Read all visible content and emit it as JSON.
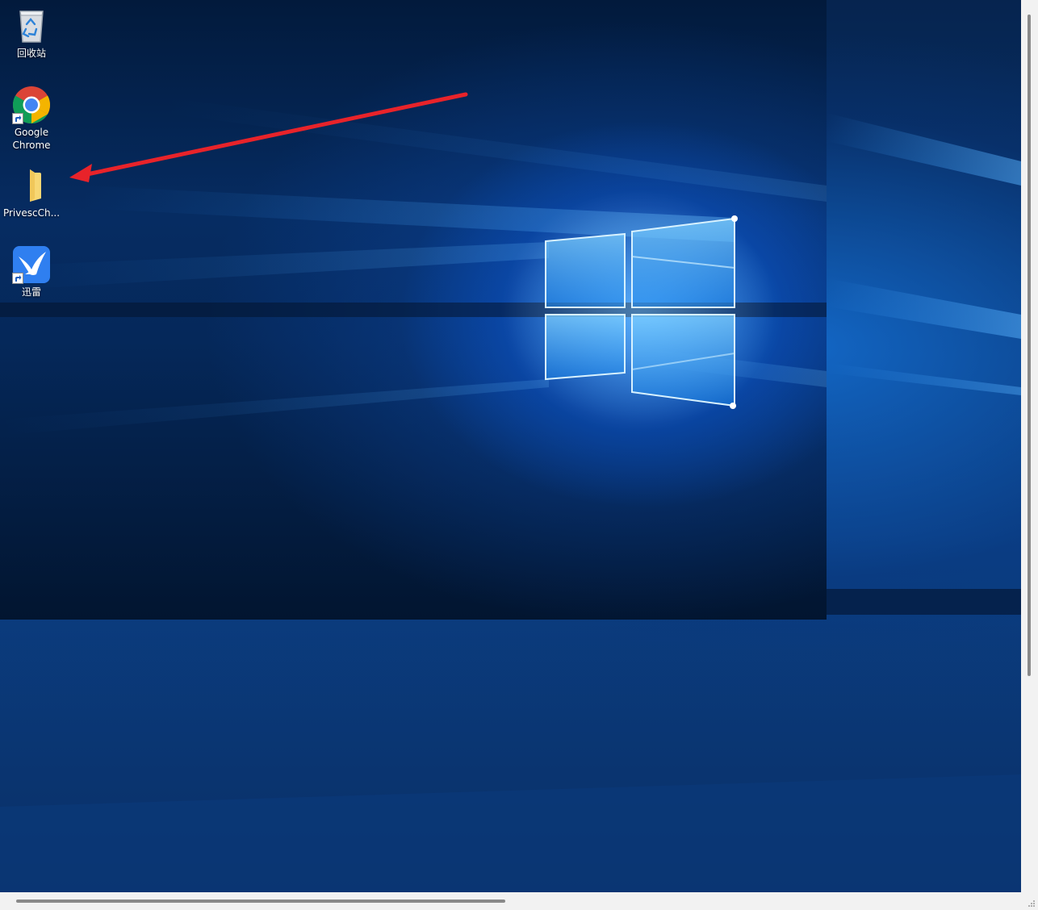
{
  "desktop": {
    "icons": [
      {
        "label": "回收站",
        "icon": "recycle-bin-icon"
      },
      {
        "label": "Google\nChrome",
        "label_line1": "Google",
        "label_line2": "Chrome",
        "icon": "chrome-icon"
      },
      {
        "label": "PrivescCh...",
        "icon": "folder-icon"
      },
      {
        "label": "迅雷",
        "icon": "xunlei-icon"
      }
    ]
  },
  "annotation": {
    "type": "arrow",
    "color": "#e8232a"
  },
  "colors": {
    "wallpaper_dark": "#021a3c",
    "wallpaper_glow": "#2896ff",
    "label_text": "#ffffff",
    "scrollbar_track": "#f2f2f2",
    "scrollbar_thumb": "#8a8a8a"
  }
}
